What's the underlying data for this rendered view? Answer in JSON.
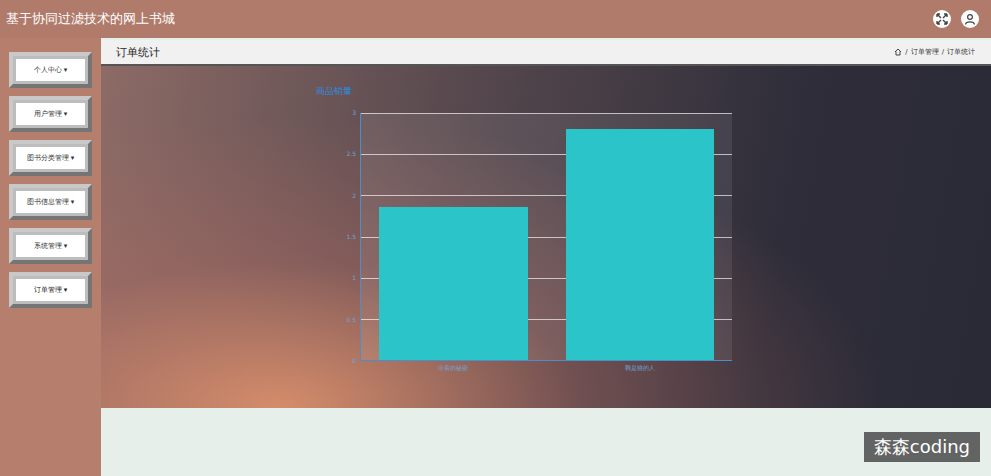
{
  "window": {
    "title": "基于协同过滤技术的网上书城"
  },
  "sidebar": {
    "items": [
      {
        "label": "个人中心",
        "selected": false
      },
      {
        "label": "用户管理",
        "selected": false
      },
      {
        "label": "图书分类管理",
        "selected": false
      },
      {
        "label": "图书信息管理",
        "selected": false
      },
      {
        "label": "系统管理",
        "selected": false
      },
      {
        "label": "订单管理",
        "selected": true
      }
    ],
    "arrow": "▾"
  },
  "page": {
    "title": "订单统计",
    "breadcrumb": [
      "订单管理",
      "订单统计"
    ],
    "separator": "/"
  },
  "chart": {
    "title": "商品销量",
    "y_ticks": [
      "0",
      "0.5",
      "1",
      "1.5",
      "2",
      "2.5",
      "3"
    ],
    "categories": [
      "活着的秘密",
      "我是猫的人"
    ],
    "series": [
      {
        "values": [
          1.86,
          2.8
        ]
      }
    ]
  },
  "watermark": "森森coding"
}
